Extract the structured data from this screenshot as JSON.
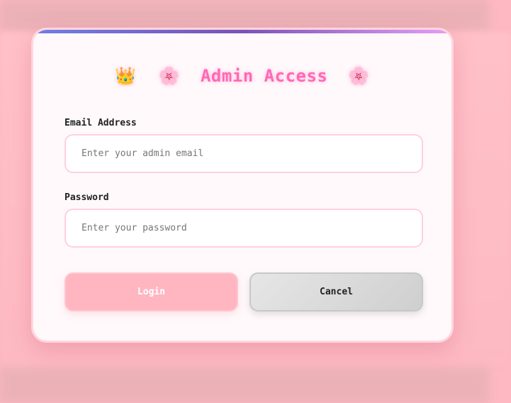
{
  "modal": {
    "title": "Admin Access",
    "title_icons": [
      "crown-icon",
      "cherry-blossom-icon",
      "cherry-blossom-icon"
    ],
    "title_glyphs": {
      "crown": "👑",
      "flower": "🌸"
    }
  },
  "form": {
    "email": {
      "label": "Email Address",
      "placeholder": "Enter your admin email",
      "value": ""
    },
    "password": {
      "label": "Password",
      "placeholder": "Enter your password",
      "value": ""
    }
  },
  "buttons": {
    "login_label": "Login",
    "cancel_label": "Cancel"
  },
  "colors": {
    "accent": "#ff69b4",
    "login_bg": "#ffb6c1",
    "background": "#fdb8c1",
    "stripe_start": "#6f7fe6",
    "stripe_end": "#e79ef5"
  }
}
